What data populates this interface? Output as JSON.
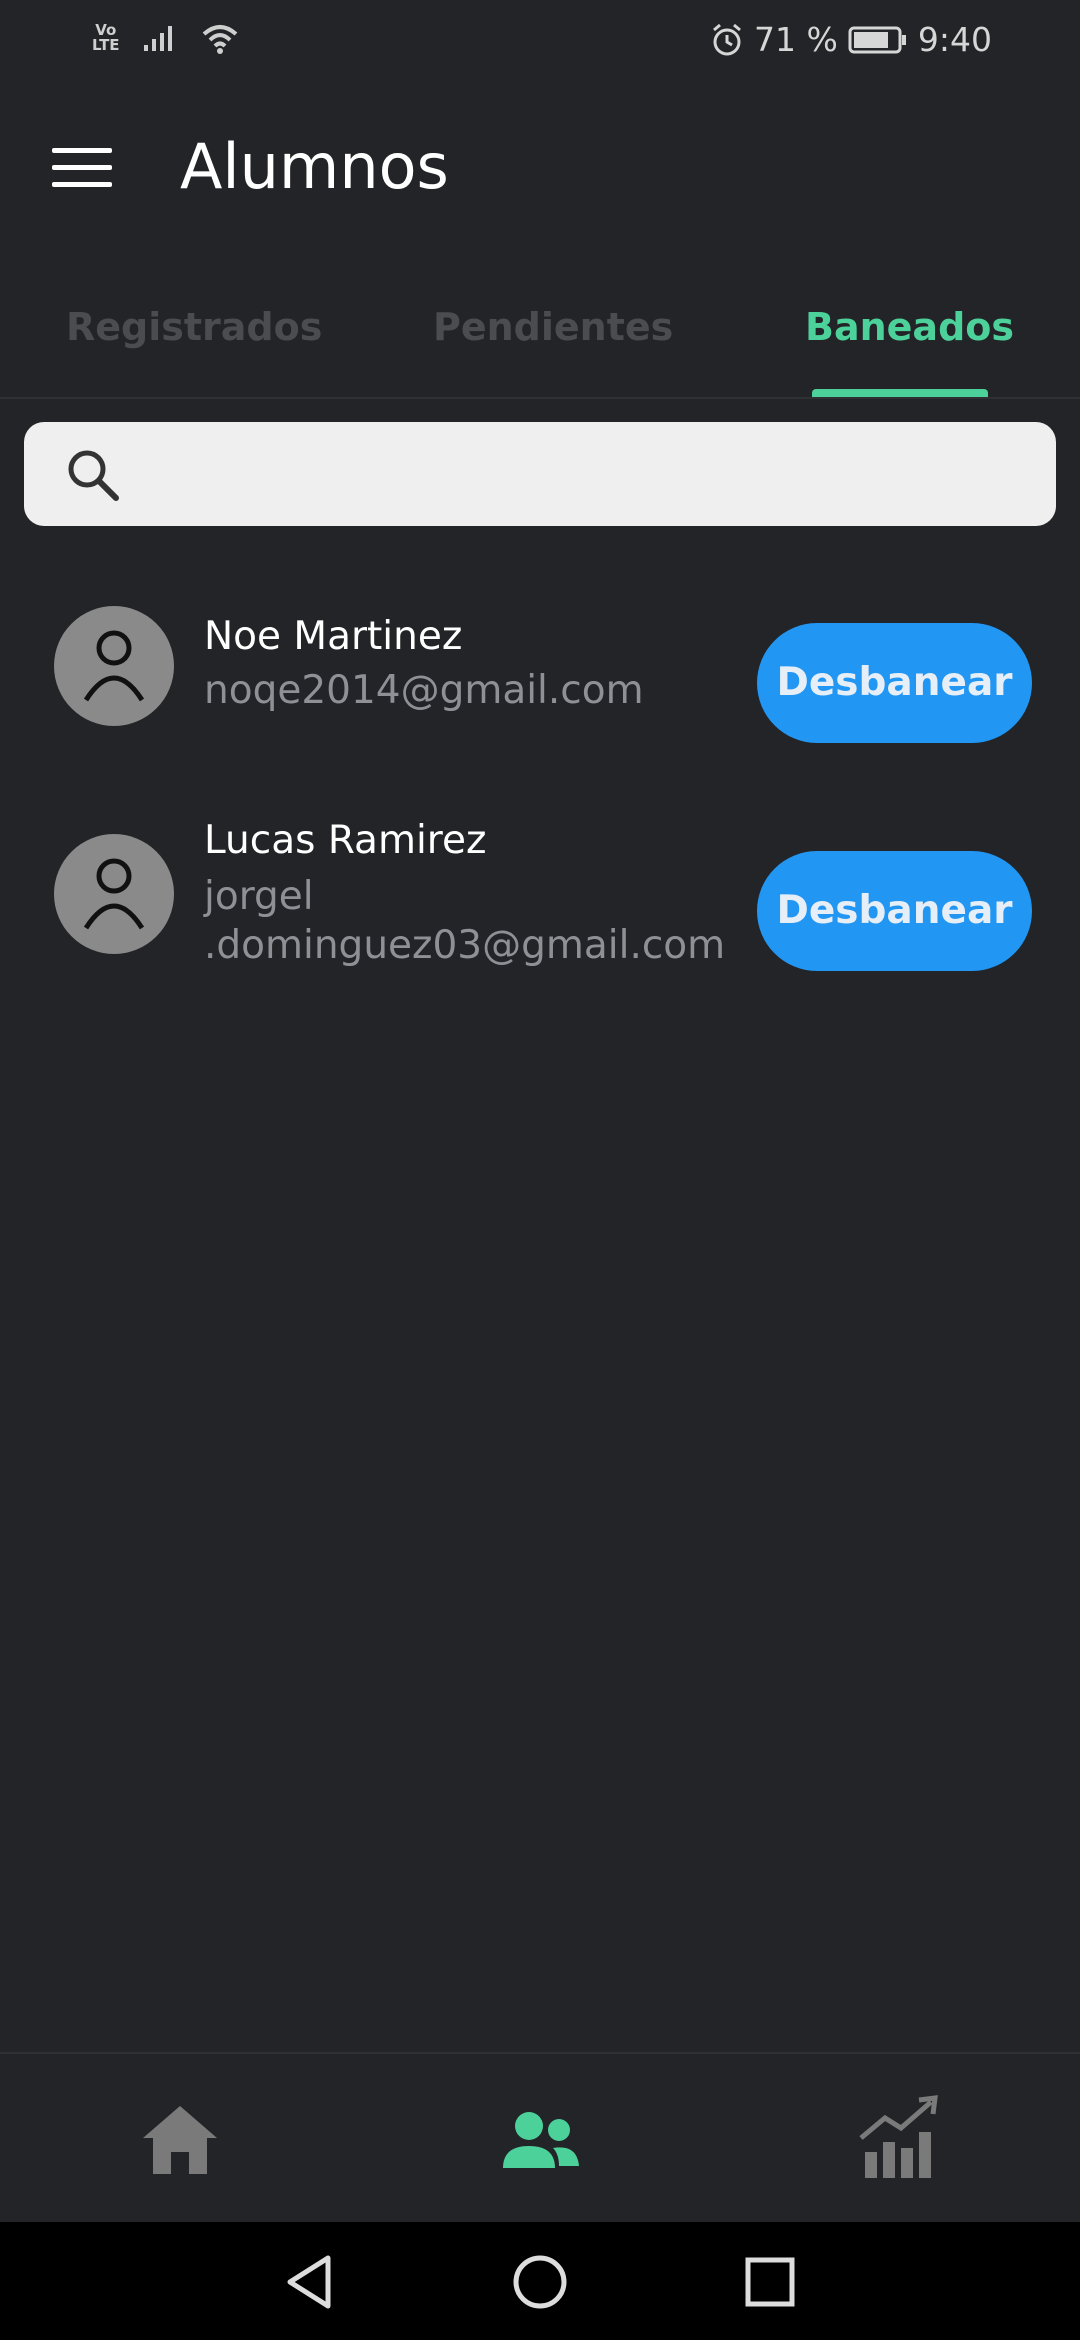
{
  "status_bar": {
    "network_label": "Vo\nLTE",
    "battery_percent": "71 %",
    "time": "9:40"
  },
  "header": {
    "title": "Alumnos"
  },
  "tabs": [
    {
      "label": "Registrados",
      "active": false
    },
    {
      "label": "Pendientes",
      "active": false
    },
    {
      "label": "Baneados",
      "active": true
    }
  ],
  "search": {
    "value": "",
    "placeholder": ""
  },
  "users": [
    {
      "name": "Noe Martinez",
      "email": "noqe2014@gmail.com",
      "action": "Desbanear"
    },
    {
      "name": "Lucas Ramirez",
      "email": "jorgel\n.dominguez03@gmail.com",
      "action": "Desbanear"
    }
  ],
  "bottom_nav": [
    {
      "icon": "home-icon",
      "active": false
    },
    {
      "icon": "users-icon",
      "active": true
    },
    {
      "icon": "stats-icon",
      "active": false
    }
  ],
  "colors": {
    "background": "#232427",
    "accent": "#4cd19a",
    "button": "#2196f3",
    "inactive": "#7a7a7a"
  }
}
